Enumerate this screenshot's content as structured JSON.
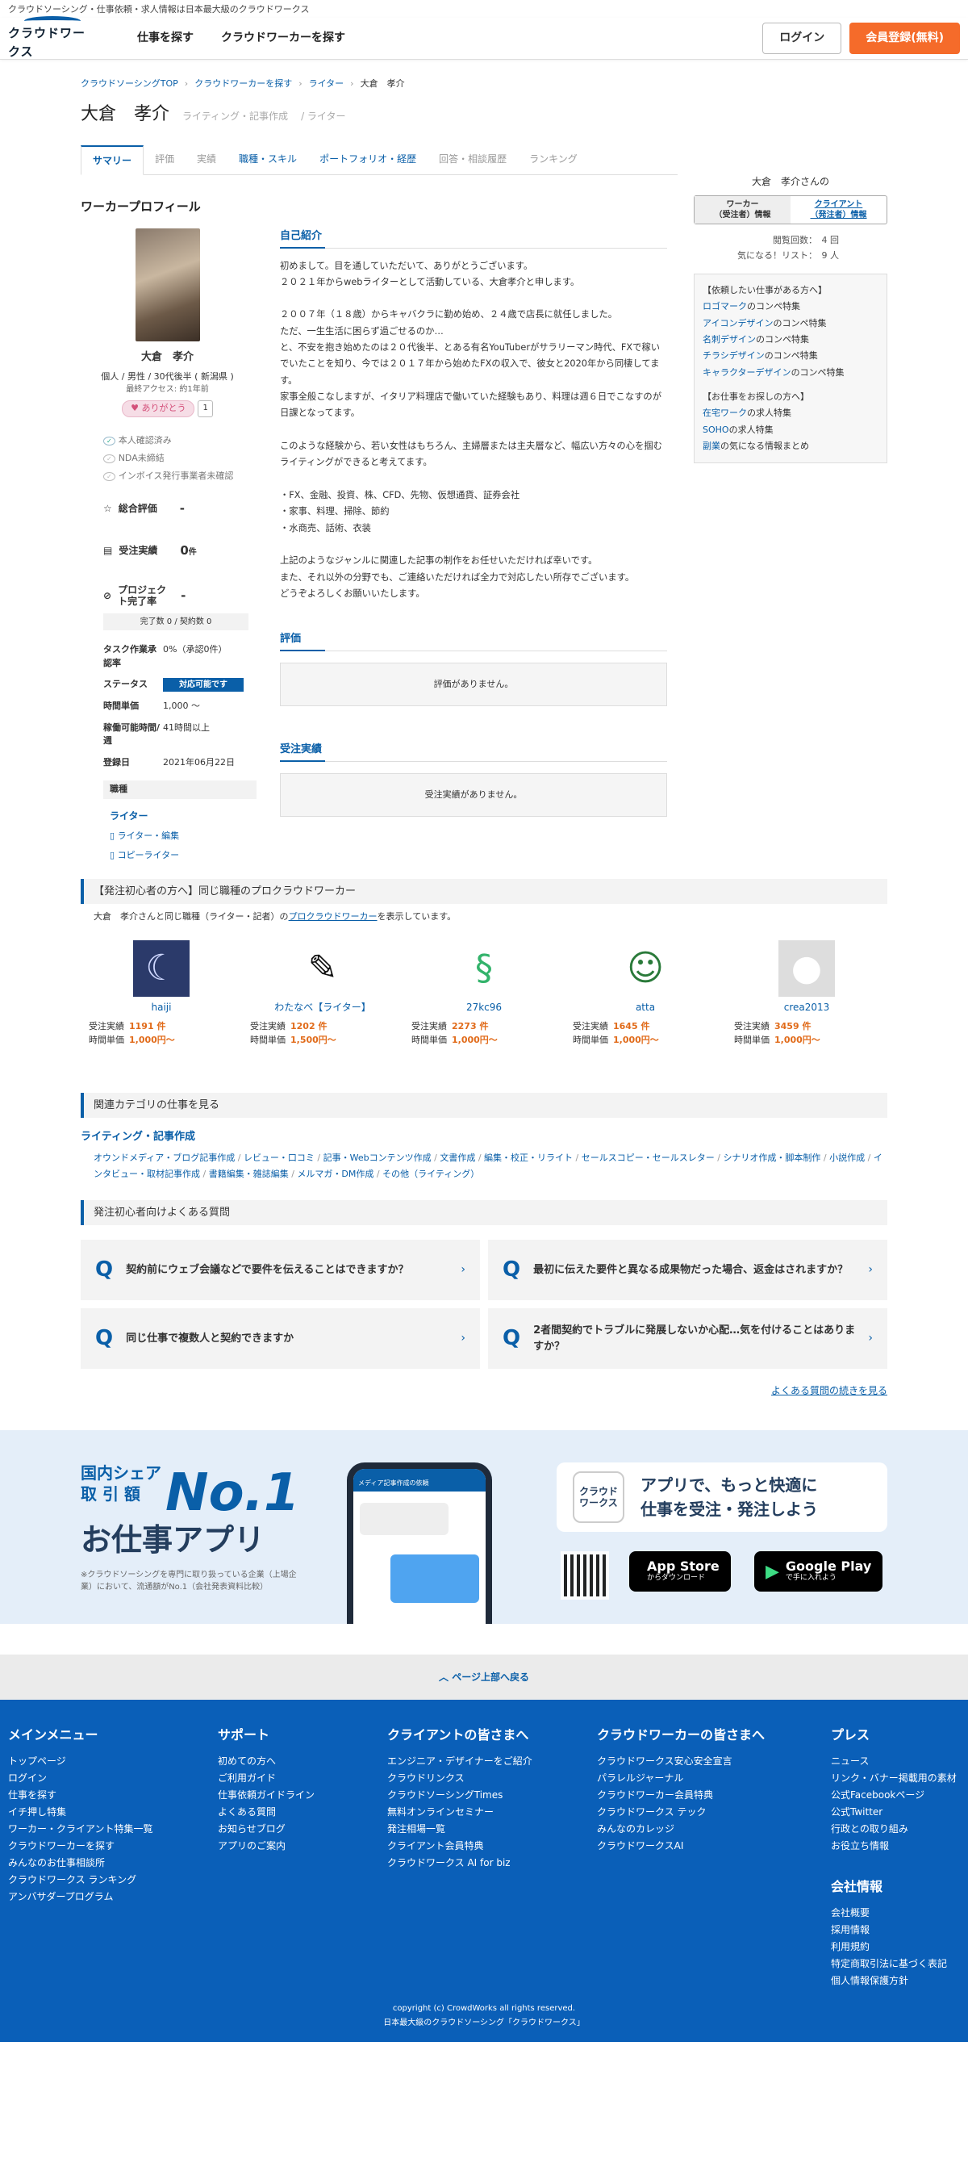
{
  "topstrip": "クラウドソーシング・仕事依頼・求人情報は日本最大級のクラウドワークス",
  "header": {
    "logo_text": "クラウドワークス",
    "nav": [
      "仕事を探す",
      "クラウドワーカーを探す"
    ],
    "login": "ログイン",
    "signup": "会員登録(無料)"
  },
  "breadcrumb": [
    "クラウドソーシングTOP",
    "クラウドワーカーを探す",
    "ライター",
    "大倉　孝介"
  ],
  "page": {
    "name": "大倉　孝介",
    "subtitle": "ライティング・記事作成",
    "subtitle2": "ライター",
    "tabs": [
      "サマリー",
      "評価",
      "実績",
      "職種・スキル",
      "ポートフォリオ・経歴",
      "回答・相談履歴",
      "ランキング"
    ]
  },
  "side": {
    "name": "大倉　孝介さんの",
    "switch_on": "ワーカー\n（受注者）情報",
    "switch_off": "クライアント\n（発注者）情報",
    "views": "閲覧回数：　4 回",
    "favorites": "気になる！リスト：　9 人",
    "box": [
      {
        "type": "hd",
        "text": "【依頼したい仕事がある方へ】"
      },
      {
        "type": "link",
        "text": "ロゴマーク",
        "rest": "のコンペ特集"
      },
      {
        "type": "link",
        "text": "アイコンデザイン",
        "rest": "のコンペ特集"
      },
      {
        "type": "link",
        "text": "名刺デザイン",
        "rest": "のコンペ特集"
      },
      {
        "type": "link",
        "text": "チラシデザイン",
        "rest": "のコンペ特集"
      },
      {
        "type": "link",
        "text": "キャラクターデザイン",
        "rest": "のコンペ特集"
      },
      {
        "type": "gap",
        "text": ""
      },
      {
        "type": "hd",
        "text": "【お仕事をお探しの方へ】"
      },
      {
        "type": "link",
        "text": "在宅ワーク",
        "rest": "の求人特集"
      },
      {
        "type": "link",
        "text": "SOHO",
        "rest": "の求人特集"
      },
      {
        "type": "link",
        "text": "副業",
        "rest": "の気になる情報まとめ"
      }
    ]
  },
  "profile": {
    "section_title": "ワーカープロフィール",
    "name": "大倉　孝介",
    "info": "個人 / 男性 / 30代後半 ( 新潟県 )",
    "access": "最終アクセス: 約1年前",
    "thanks_label": "ありがとう",
    "thanks_count": "1",
    "verify": [
      {
        "ok": true,
        "text": "本人確認済み"
      },
      {
        "ok": false,
        "text": "NDA未締結"
      },
      {
        "ok": false,
        "text": "インボイス発行事業者未確認"
      }
    ],
    "rating_label": "総合評価",
    "rating_value": "-",
    "orders_label": "受注実績",
    "orders_value": "0",
    "orders_unit": "件",
    "completion_label": "プロジェクト完了率",
    "completion_value": "-",
    "completion_sub": "完了数 0 / 契約数 0",
    "details": [
      {
        "k": "タスク作業承認率",
        "v": "0%（承認0件）"
      },
      {
        "k": "ステータス",
        "v": "対応可能です",
        "badge": true
      },
      {
        "k": "時間単価",
        "v": "1,000 〜"
      },
      {
        "k": "稼働可能時間/週",
        "v": "41時間以上"
      },
      {
        "k": "登録日",
        "v": "2021年06月22日"
      }
    ],
    "jobcat_title": "職種",
    "jobcat_main": "ライター",
    "jobcat_subs": [
      "ライター・編集",
      "コピーライター"
    ]
  },
  "intro": {
    "title": "自己紹介",
    "lines": [
      "初めまして。目を通していただいて、ありがとうございます。",
      "２０２１年からwebライターとして活動している、大倉孝介と申します。",
      "",
      "２００７年（１８歳）からキャバクラに勤め始め、２４歳で店長に就任しました。",
      "ただ、一生生活に困らず過ごせるのか…",
      "と、不安を抱き始めたのは２０代後半、とある有名YouTuberがサラリーマン時代、FXで稼いでいたことを知り、今では２０１７年から始めたFXの収入で、彼女と2020年から同棲してます。",
      "家事全般こなしますが、イタリア料理店で働いていた経験もあり、料理は週６日でこなすのが日課となってます。",
      "",
      "このような経験から、若い女性はもちろん、主婦層または主夫層など、幅広い方々の心を掴むライティングができると考えてます。",
      "",
      "・FX、金融、投資、株、CFD、先物、仮想通貨、証券会社",
      "・家事、料理、掃除、節約",
      "・水商売、話術、衣装",
      "",
      "上記のようなジャンルに関連した記事の制作をお任せいただければ幸いです。",
      "また、それ以外の分野でも、ご連絡いただければ全力で対応したい所存でございます。",
      "どうぞよろしくお願いいたします。"
    ],
    "review_title": "評価",
    "review_empty": "評価がありません。",
    "orders_title": "受注実績",
    "orders_empty": "受注実績がありません。"
  },
  "similar": {
    "banner": "【発注初心者の方へ】同じ職種のプロクラウドワーカー",
    "note_pre": "大倉　孝介さんと同じ職種（ライター・記者）の",
    "note_link": "プロクラウドワーカー",
    "note_post": "を表示しています。",
    "order_label": "受注実績",
    "rate_label": "時間単価",
    "workers": [
      {
        "name": "haiji",
        "orders": "1191 件",
        "rate": "1,000円〜",
        "icon": "night-photo"
      },
      {
        "name": "わたなべ【ライター】",
        "orders": "1202 件",
        "rate": "1,500円〜",
        "icon": "pen"
      },
      {
        "name": "27kc96",
        "orders": "2273 件",
        "rate": "1,000円〜",
        "icon": "lizard"
      },
      {
        "name": "atta",
        "orders": "1645 件",
        "rate": "1,000円〜",
        "icon": "person-desk"
      },
      {
        "name": "crea2013",
        "orders": "3459 件",
        "rate": "1,000円〜",
        "icon": "default-avatar"
      }
    ]
  },
  "related": {
    "banner": "関連カテゴリの仕事を見る",
    "title": "ライティング・記事作成",
    "links": [
      "オウンドメディア・ブログ記事作成",
      "レビュー・口コミ",
      "記事・Webコンテンツ作成",
      "文書作成",
      "編集・校正・リライト",
      "セールスコピー・セールスレター",
      "シナリオ作成・脚本制作",
      "小説作成",
      "インタビュー・取材記事作成",
      "書籍編集・雑誌編集",
      "メルマガ・DM作成",
      "その他（ライティング）"
    ]
  },
  "faq": {
    "banner": "発注初心者向けよくある質問",
    "items": [
      "契約前にウェブ会議などで要件を伝えることはできますか？",
      "最初に伝えた要件と異なる成果物だった場合、返金はされますか？",
      "同じ仕事で複数人と契約できますか",
      "2者間契約でトラブルに発展しないか心配…気を付けることはありますか？"
    ],
    "more": "よくある質問の続きを見る"
  },
  "promo": {
    "line1": "国内シェア",
    "line2": "取 引 額",
    "no1": "No.1",
    "app": "お仕事アプリ",
    "note": "※クラウドソーシングを専門に取り扱っている企業（上場企業）において、流通額がNo.1（会社発表資料比較）",
    "phone_header": "メディア記事作成の依頼",
    "catch_icon": "クラウド\nワークス",
    "catch": "アプリで、もっと快適に\n仕事を受注・発注しよう",
    "appstore_small": "",
    "appstore_big": "App Store",
    "appstore_sub": "からダウンロード",
    "gplay_big": "Google Play",
    "gplay_sub": "で手に入れよう"
  },
  "backtop": "︿ ページ上部へ戻る",
  "footer": {
    "cols": [
      {
        "h": "メインメニュー",
        "items": [
          "トップページ",
          "ログイン",
          "仕事を探す",
          "イチ押し特集",
          "ワーカー・クライアント特集一覧",
          "クラウドワーカーを探す",
          "みんなのお仕事相談所",
          "クラウドワークス ランキング",
          "アンバサダープログラム"
        ]
      },
      {
        "h": "サポート",
        "items": [
          "初めての方へ",
          "ご利用ガイド",
          "仕事依頼ガイドライン",
          "よくある質問",
          "お知らせブログ",
          "アプリのご案内"
        ]
      },
      {
        "h": "クライアントの皆さまへ",
        "items": [
          "エンジニア・デザイナーをご紹介",
          "クラウドリンクス",
          "クラウドソーシングTimes",
          "無料オンラインセミナー",
          "発注相場一覧",
          "クライアント会員特典",
          "クラウドワークス AI for biz"
        ]
      },
      {
        "h": "クラウドワーカーの皆さまへ",
        "items": [
          "クラウドワークス安心安全宣言",
          "パラレルジャーナル",
          "クラウドワーカー会員特典",
          "クラウドワークス テック",
          "みんなのカレッジ",
          "クラウドワークスAI"
        ]
      },
      {
        "h": "プレス",
        "items": [
          "ニュース",
          "リンク・バナー掲載用の素材",
          "公式Facebookページ",
          "公式Twitter",
          "行政との取り組み",
          "お役立ち情報"
        ]
      }
    ],
    "company_h": "会社情報",
    "company_items": [
      "会社概要",
      "採用情報",
      "利用規約",
      "特定商取引法に基づく表記",
      "個人情報保護方針"
    ],
    "copyright": "copyright (c) CrowdWorks all rights reserved.",
    "tagline": "日本最大級のクラウドソーシング「クラウドワークス」"
  }
}
